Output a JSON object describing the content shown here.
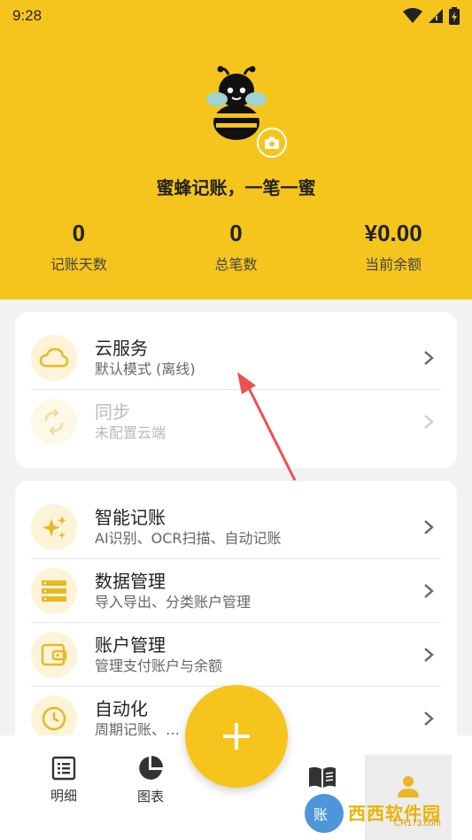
{
  "status_bar": {
    "time": "9:28"
  },
  "header": {
    "slogan": "蜜蜂记账，一笔一蜜",
    "stats": [
      {
        "value": "0",
        "label": "记账天数"
      },
      {
        "value": "0",
        "label": "总笔数"
      },
      {
        "value": "¥0.00",
        "label": "当前余额"
      }
    ]
  },
  "cloud_card": {
    "items": [
      {
        "title": "云服务",
        "subtitle": "默认模式 (离线)",
        "icon": "cloud-icon",
        "enabled": true
      },
      {
        "title": "同步",
        "subtitle": "未配置云端",
        "icon": "sync-icon",
        "enabled": false
      }
    ]
  },
  "feature_card": {
    "items": [
      {
        "title": "智能记账",
        "subtitle": "AI识别、OCR扫描、自动记账",
        "icon": "sparkle-icon"
      },
      {
        "title": "数据管理",
        "subtitle": "导入导出、分类账户管理",
        "icon": "database-icon"
      },
      {
        "title": "账户管理",
        "subtitle": "管理支付账户与余额",
        "icon": "wallet-icon"
      },
      {
        "title": "自动化",
        "subtitle": "周期记账、…",
        "icon": "clock-icon"
      }
    ]
  },
  "bottom_nav": {
    "items": [
      {
        "label": "明细",
        "icon": "list-icon"
      },
      {
        "label": "图表",
        "icon": "pie-chart-icon"
      },
      {
        "label": "",
        "icon": "book-icon"
      },
      {
        "label": "",
        "icon": "person-icon"
      }
    ]
  },
  "watermark": {
    "text": "西西软件园",
    "sub": "CR173.com",
    "badge": "账"
  },
  "colors": {
    "brand": "#f6c51d",
    "icon_bg": "#fdf4d7"
  }
}
